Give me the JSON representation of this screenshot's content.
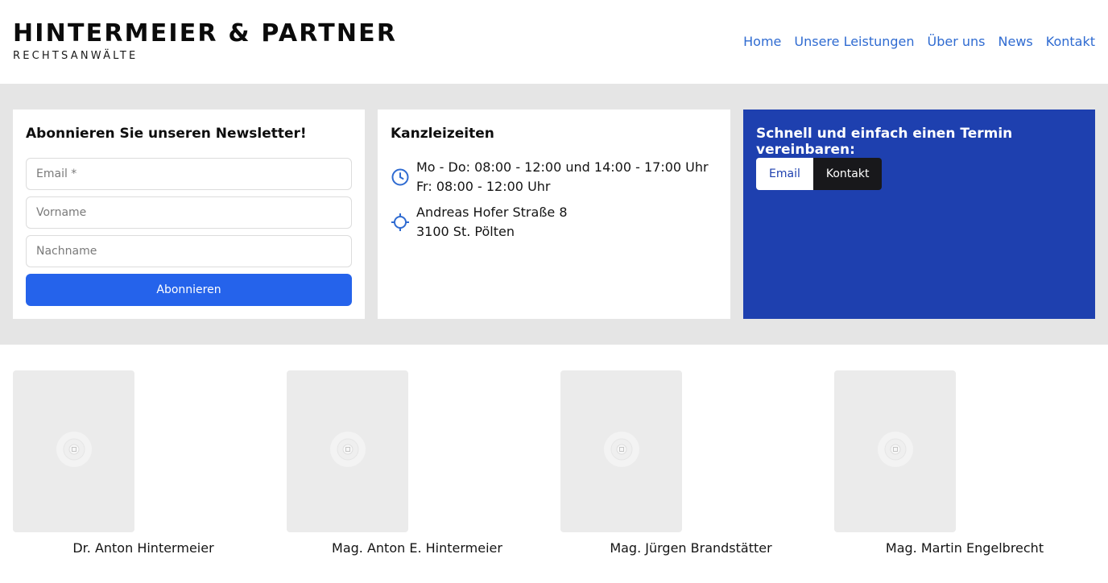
{
  "header": {
    "title": "HINTERMEIER & PARTNER",
    "subtitle": "RECHTSANWÄLTE",
    "nav": [
      "Home",
      "Unsere Leistungen",
      "Über uns",
      "News",
      "Kontakt"
    ]
  },
  "newsletter": {
    "title": "Abonnieren Sie unseren Newsletter!",
    "email_placeholder": "Email *",
    "firstname_placeholder": "Vorname",
    "lastname_placeholder": "Nachname",
    "submit_label": "Abonnieren"
  },
  "hours": {
    "title": "Kanzleizeiten",
    "line1": "Mo - Do: 08:00 - 12:00 und 14:00 - 17:00 Uhr",
    "line2": "Fr: 08:00 - 12:00 Uhr",
    "address1": "Andreas Hofer Straße 8",
    "address2": "3100 St. Pölten"
  },
  "appointment": {
    "title": "Schnell und einfach einen Termin vereinbaren:",
    "email_label": "Email",
    "contact_label": "Kontakt"
  },
  "team": [
    {
      "name": "Dr. Anton Hintermeier"
    },
    {
      "name": "Mag. Anton E. Hintermeier"
    },
    {
      "name": "Mag. Jürgen Brandstätter"
    },
    {
      "name": "Mag. Martin Engelbrecht"
    }
  ],
  "colors": {
    "nav_link": "#2f6bd1",
    "band": "#e5e5e5",
    "subscribe_button": "#2563eb",
    "appointment_card": "#1e40af",
    "dark_button": "#18181b"
  },
  "icons": {
    "hours": "clock-icon",
    "address": "crosshair-icon",
    "photo_placeholder": "image-placeholder-icon"
  }
}
